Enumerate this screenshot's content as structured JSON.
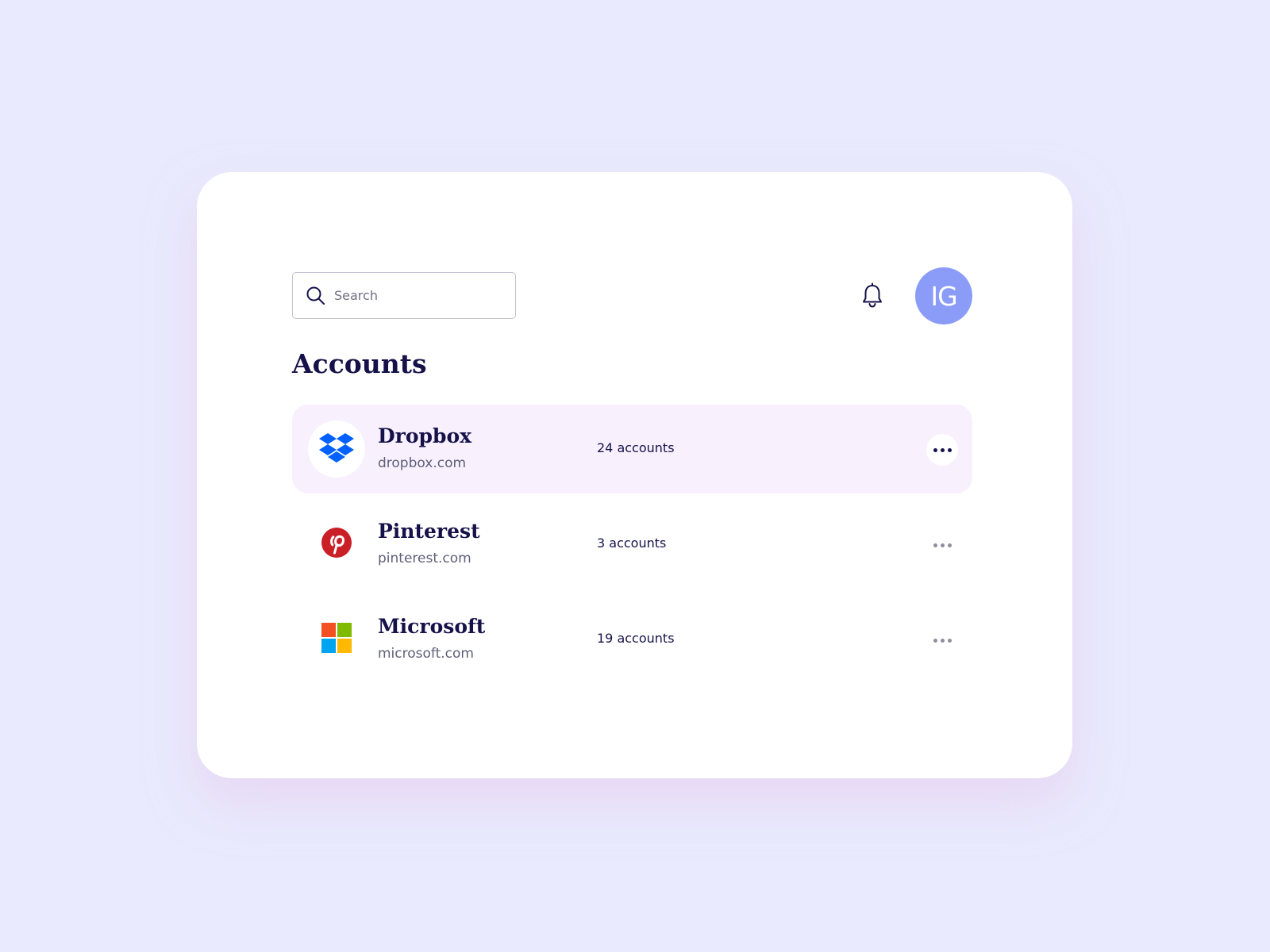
{
  "header": {
    "search": {
      "placeholder": "Search",
      "value": ""
    },
    "notifications_icon": "bell-icon",
    "avatar_initials": "IG",
    "avatar_color": "#8a9cf7"
  },
  "page": {
    "title": "Accounts"
  },
  "accounts": [
    {
      "name": "Dropbox",
      "domain": "dropbox.com",
      "count": "24 accounts",
      "icon": "dropbox-icon",
      "selected": true
    },
    {
      "name": "Pinterest",
      "domain": "pinterest.com",
      "count": "3 accounts",
      "icon": "pinterest-icon",
      "selected": false
    },
    {
      "name": "Microsoft",
      "domain": "microsoft.com",
      "count": "19 accounts",
      "icon": "microsoft-icon",
      "selected": false
    }
  ],
  "colors": {
    "background": "#e9eafd",
    "card": "#ffffff",
    "selected_row": "#f8f0fd",
    "title_text": "#15124a",
    "muted_text": "#5f5f7a",
    "dropbox_blue": "#0061fe",
    "pinterest_red": "#cb1f27"
  }
}
